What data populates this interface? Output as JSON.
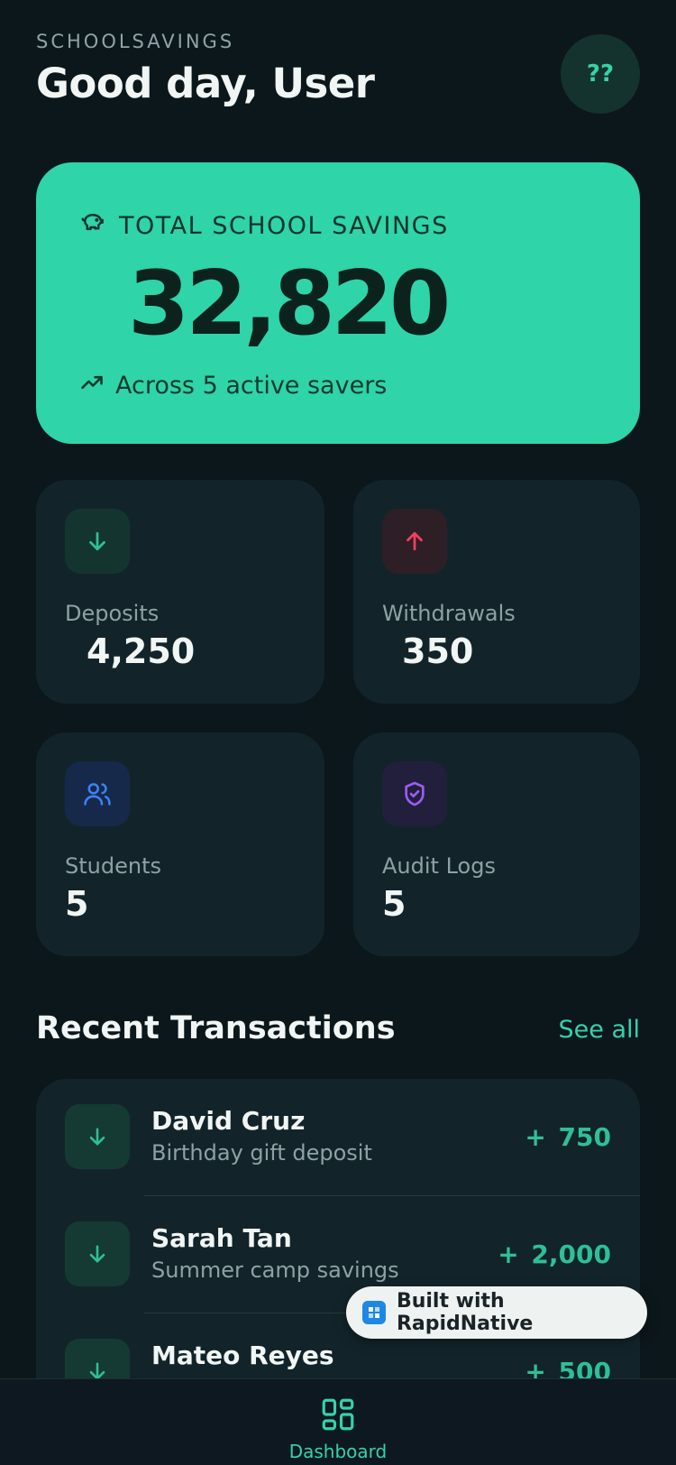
{
  "header": {
    "app_name": "SCHOOLSAVINGS",
    "greeting": "Good day, User",
    "avatar_text": "??"
  },
  "hero": {
    "label": "TOTAL SCHOOL SAVINGS",
    "amount": "32,820",
    "subtitle": "Across 5 active savers",
    "icon": "piggy-bank-icon",
    "sub_icon": "trending-up-icon"
  },
  "stats": [
    {
      "label": "Deposits",
      "value": "4,250",
      "icon": "arrow-down-icon",
      "color": "#2fbf96"
    },
    {
      "label": "Withdrawals",
      "value": "350",
      "icon": "arrow-up-icon",
      "color": "#f0405e"
    },
    {
      "label": "Students",
      "value": "5",
      "icon": "users-icon",
      "color": "#3b82f6"
    },
    {
      "label": "Audit Logs",
      "value": "5",
      "icon": "shield-check-icon",
      "color": "#9b5cf6"
    }
  ],
  "transactions": {
    "title": "Recent Transactions",
    "see_all": "See all",
    "items": [
      {
        "name": "David Cruz",
        "description": "Birthday gift deposit",
        "amount": "+ 750"
      },
      {
        "name": "Sarah Tan",
        "description": "Summer camp savings",
        "amount": "+ 2,000"
      },
      {
        "name": "Mateo Reyes",
        "description": "",
        "amount": "+ 500"
      }
    ]
  },
  "badge": {
    "text": "Built with RapidNative"
  },
  "nav": {
    "dashboard_label": "Dashboard"
  },
  "colors": {
    "background": "#0c171b",
    "accent": "#2fd4a8",
    "card": "#12242a"
  }
}
